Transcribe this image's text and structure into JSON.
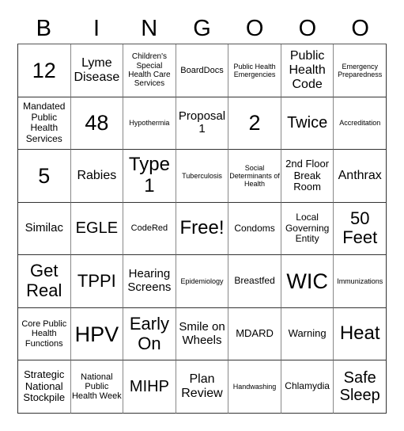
{
  "header": [
    "B",
    "I",
    "N",
    "G",
    "O",
    "O",
    "O"
  ],
  "cells": [
    "12",
    "Lyme Disease",
    "Children's Special Health Care Services",
    "BoardDocs",
    "Public Health Emergencies",
    "Public Health Code",
    "Emergency Preparedness",
    "Mandated Public Health Services",
    "48",
    "Hypothermia",
    "Proposal 1",
    "2",
    "Twice",
    "Accreditation",
    "5",
    "Rabies",
    "Type 1",
    "Tuberculosis",
    "Social Determinants of Health",
    "2nd Floor Break Room",
    "Anthrax",
    "Similac",
    "EGLE",
    "CodeRed",
    "Free!",
    "Condoms",
    "Local Governing Entity",
    "50 Feet",
    "Get Real",
    "TPPI",
    "Hearing Screens",
    "Epidemiology",
    "Breastfed",
    "WIC",
    "Immunizations",
    "Core Public Health Functions",
    "HPV",
    "Early On",
    "Smile on Wheels",
    "MDARD",
    "Warning",
    "Heat",
    "Strategic National Stockpile",
    "National Public Health Week",
    "MIHP",
    "Plan Review",
    "Handwashing",
    "Chlamydia",
    "Safe Sleep"
  ]
}
